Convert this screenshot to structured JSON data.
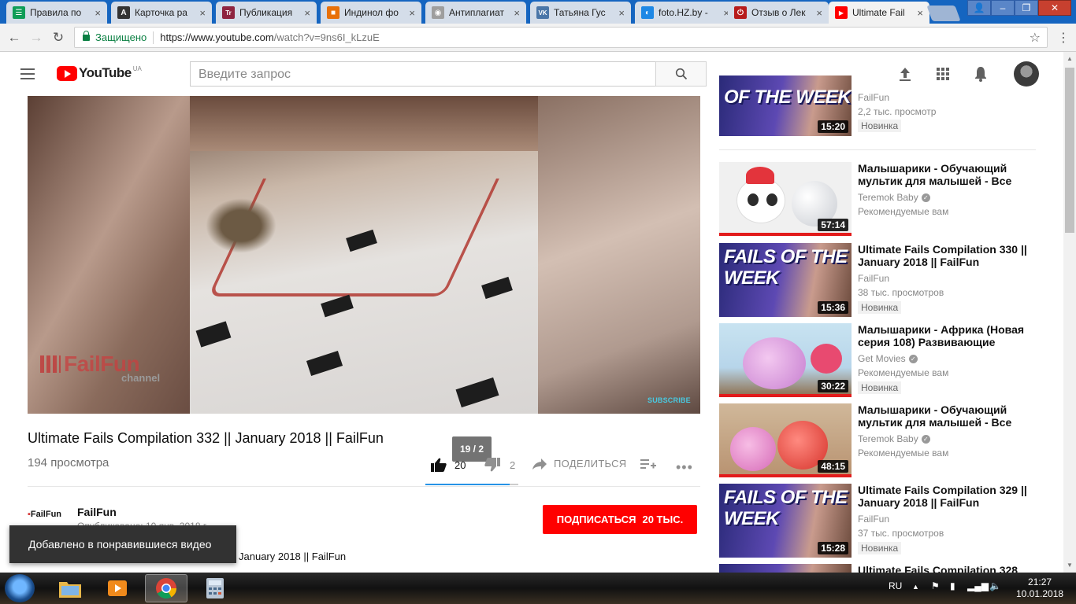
{
  "browser": {
    "tabs": [
      {
        "label": "Правила по",
        "fav_color": "#0f9d58",
        "fav_char": "☰"
      },
      {
        "label": "Карточка ра",
        "fav_color": "#333333",
        "fav_char": "A"
      },
      {
        "label": "Публикация",
        "fav_color": "#8e2440",
        "fav_char": "Tr"
      },
      {
        "label": "Индинол фо",
        "fav_color": "#e8710a",
        "fav_char": "■"
      },
      {
        "label": "Антиплагиат",
        "fav_color": "#9e9e9e",
        "fav_char": "◉"
      },
      {
        "label": "Татьяна Гус",
        "fav_color": "#4a76a8",
        "fav_char": "VK"
      },
      {
        "label": "foto.HZ.by -",
        "fav_color": "#1e88e5",
        "fav_char": "◐"
      },
      {
        "label": "Отзыв о Лек",
        "fav_color": "#b71c1c",
        "fav_char": "⏻"
      },
      {
        "label": "Ultimate Fail",
        "fav_color": "#ff0000",
        "fav_char": "▶"
      }
    ],
    "secure_label": "Защищено",
    "url_host": "https://www.youtube.com",
    "url_path": "/watch?v=9ns6I_kLzuE"
  },
  "yt": {
    "logo_word": "YouTube",
    "logo_region": "UA",
    "search_placeholder": "Введите запрос"
  },
  "video": {
    "watermark_name": "FailFun",
    "watermark_sub": "channel",
    "subscribe_watermark": "SUBSCRIBE",
    "title": "Ultimate Fails Compilation 332 || January 2018 || FailFun",
    "views": "194 просмотра",
    "likes": "20",
    "dislikes": "2",
    "like_ratio_tooltip": "19 / 2",
    "like_ratio": 0.91,
    "share_label": "ПОДЕЛИТЬСЯ",
    "channel_logo": "FailFun",
    "channel_name": "FailFun",
    "published": "Опубликовано: 10 янв. 2018 г.",
    "subscribe_label": "ПОДПИСАТЬСЯ",
    "subscribers": "20 ТЫС.",
    "description_tail": "January 2018 || FailFun",
    "toast": "Добавлено в понравившиеся видео"
  },
  "sidebar": {
    "items": [
      {
        "title": "",
        "channel": "FailFun",
        "meta": "2,2 тыс. просмотр",
        "duration": "15:20",
        "badge": "Новинка",
        "thumb_text": "OF THE WEEK",
        "verified": false
      },
      {
        "title": "Малышарики - Обучающий мультик для малышей - Все",
        "channel": "Teremok Baby",
        "meta": "Рекомендуемые вам",
        "duration": "57:14",
        "badge": "",
        "verified": true
      },
      {
        "title": "Ultimate Fails Compilation 330 || January 2018 || FailFun",
        "channel": "FailFun",
        "meta": "38 тыс. просмотров",
        "duration": "15:36",
        "badge": "Новинка",
        "thumb_text": "FAILS OF THE WEEK",
        "verified": false
      },
      {
        "title": "Малышарики - Африка (Новая серия 108) Развивающие",
        "channel": "Get Movies",
        "meta": "Рекомендуемые вам",
        "duration": "30:22",
        "badge": "Новинка",
        "verified": true
      },
      {
        "title": "Малышарики - Обучающий мультик для малышей - Все",
        "channel": "Teremok Baby",
        "meta": "Рекомендуемые вам",
        "duration": "48:15",
        "badge": "",
        "verified": true
      },
      {
        "title": "Ultimate Fails Compilation 329 || January 2018 || FailFun",
        "channel": "FailFun",
        "meta": "37 тыс. просмотров",
        "duration": "15:28",
        "badge": "Новинка",
        "thumb_text": "FAILS OF THE WEEK",
        "verified": false
      },
      {
        "title": "Ultimate Fails Compilation 328",
        "channel": "",
        "meta": "",
        "duration": "",
        "badge": "",
        "verified": false
      }
    ]
  },
  "taskbar": {
    "lang": "RU",
    "time": "21:27",
    "date": "10.01.2018"
  },
  "colors": {
    "yt_red": "#ff0000",
    "like_blue": "#2793e6",
    "chrome_blue": "#1565c0"
  }
}
